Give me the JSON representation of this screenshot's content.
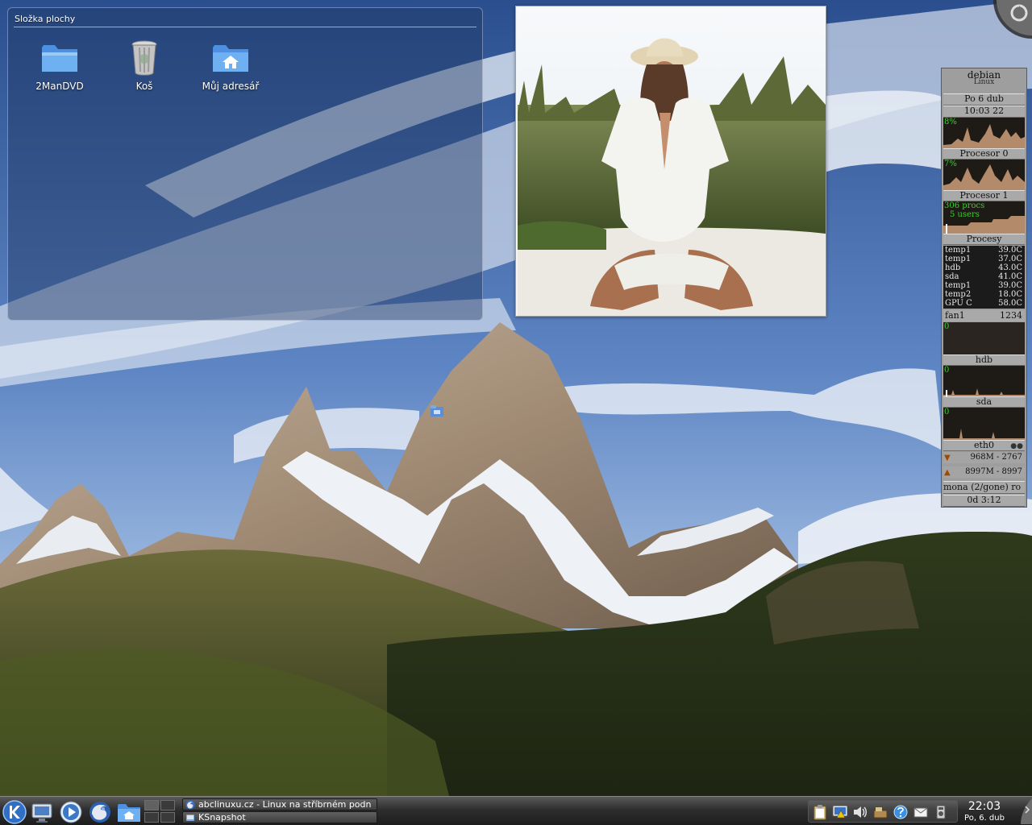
{
  "desktop": {
    "folder_view": {
      "title": "Složka plochy",
      "icons": [
        {
          "label": "2ManDVD",
          "icon": "folder-icon"
        },
        {
          "label": "Koš",
          "icon": "trash-icon"
        },
        {
          "label": "Můj adresář",
          "icon": "home-folder-icon"
        }
      ]
    }
  },
  "system_monitor": {
    "host": "debian",
    "host_sub": "Linux",
    "date": "Po 6 dub",
    "time": "10:03 22",
    "cpu0": {
      "label": "Procesor 0",
      "value": "8%",
      "percent": 8
    },
    "cpu1": {
      "label": "Procesor 1",
      "value": "7%",
      "percent": 7
    },
    "procs": {
      "label": "Procesy",
      "procs": "306 procs",
      "users": "5 users"
    },
    "temps": [
      {
        "name": "temp1",
        "value": "39.0C"
      },
      {
        "name": "temp1",
        "value": "37.0C"
      },
      {
        "name": "hdb",
        "value": "43.0C"
      },
      {
        "name": "sda",
        "value": "41.0C"
      },
      {
        "name": "temp1",
        "value": "39.0C"
      },
      {
        "name": "temp2",
        "value": "18.0C"
      },
      {
        "name": "GPU C",
        "value": "58.0C"
      }
    ],
    "fan": {
      "name": "fan1",
      "value": "1234"
    },
    "fan_graph_value": "0",
    "hdb": {
      "label": "hdb",
      "value": "0"
    },
    "sda": {
      "label": "sda",
      "value": "0"
    },
    "net": {
      "label": "eth0",
      "rx": "968M - 2767",
      "tx": "8997M - 8997"
    },
    "user": "mona (2/gone) ro",
    "uptime": "0d 3:12"
  },
  "taskbar": {
    "tasks": [
      {
        "label": "abclinuxu.cz - Linux na stříbrném podn"
      },
      {
        "label": "KSnapshot"
      }
    ],
    "clock": {
      "time": "22:03",
      "date": "Po, 6. dub"
    },
    "launchers": [
      "kde-menu-icon",
      "system-settings-icon",
      "media-player-icon",
      "firefox-icon",
      "home-folder-icon"
    ],
    "tray_icons": [
      "clipboard-icon",
      "display-icon",
      "volume-icon",
      "network-icon",
      "messenger-icon",
      "mail-icon",
      "device-icon"
    ]
  },
  "colors": {
    "graph_bg": "#1e1a16",
    "graph_fill": "#b38a6a",
    "graph_text": "#38d22c",
    "panel": "#2e2e2e"
  }
}
